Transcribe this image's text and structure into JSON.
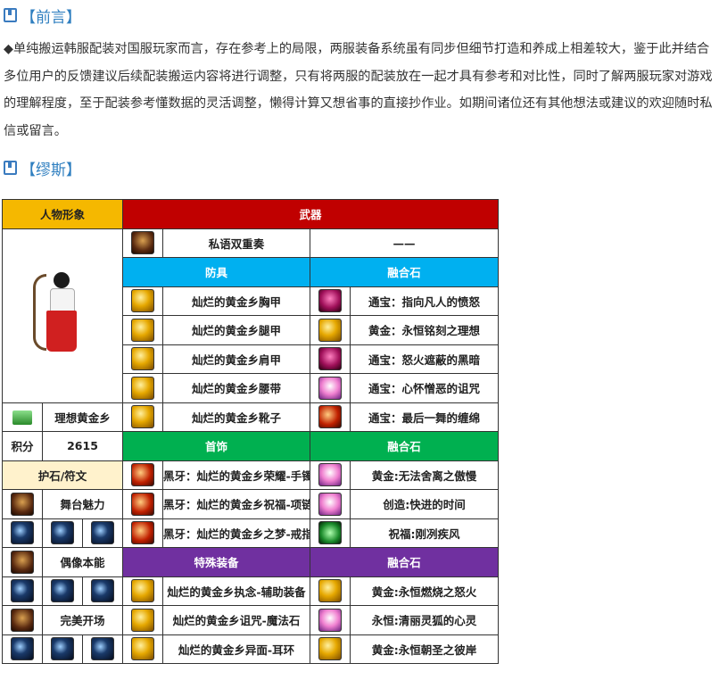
{
  "preface": {
    "title": "【前言】",
    "text": "◆单纯搬运韩服配装对国服玩家而言，存在参考上的局限，两服装备系统虽有同步但细节打造和养成上相差较大，鉴于此并结合多位用户的反馈建议后续配装搬运内容将进行调整，只有将两服的配装放在一起才具有参考和对比性，同时了解两服玩家对游戏的理解程度，至于配装参考懂数据的灵活调整，懒得计算又想省事的直接抄作业。如期间诸位还有其他想法或建议的欢迎随时私信或留言。"
  },
  "section": {
    "title": "【缪斯】"
  },
  "table": {
    "char_header": "人物形象",
    "weapon_header": "武器",
    "weapon": {
      "name": "私语双重奏",
      "fusion": "——"
    },
    "armor_header": "防具",
    "fusion_header": "融合石",
    "armor": [
      {
        "name": "灿烂的黄金乡胸甲",
        "fusion": "通宝：指向凡人的愤怒"
      },
      {
        "name": "灿烂的黄金乡腿甲",
        "fusion": "黄金：永恒铭刻之理想"
      },
      {
        "name": "灿烂的黄金乡肩甲",
        "fusion": "通宝：怒火遮蔽的黑暗"
      },
      {
        "name": "灿烂的黄金乡腰带",
        "fusion": "通宝：心怀憎恶的诅咒"
      },
      {
        "name": "灿烂的黄金乡靴子",
        "fusion": "通宝：最后一舞的缠绵"
      }
    ],
    "set_name": "理想黄金乡",
    "score_label": "积分",
    "score_value": "2615",
    "accessory_header": "首饰",
    "accessory": [
      {
        "name": "黑牙：灿烂的黄金乡荣耀-手镯",
        "fusion": "黄金:无法舍离之傲慢"
      },
      {
        "name": "黑牙：灿烂的黄金乡祝福-项链",
        "fusion": "创造:快进的时间"
      },
      {
        "name": "黑牙：灿烂的黄金乡之梦-戒指",
        "fusion": "祝福:刚冽疾风"
      }
    ],
    "talisman_header": "护石/符文",
    "talismans": [
      "舞台魅力",
      "偶像本能",
      "完美开场"
    ],
    "special_header": "特殊装备",
    "special": [
      {
        "name": "灿烂的黄金乡执念-辅助装备",
        "fusion": "黄金:永恒燃烧之怒火"
      },
      {
        "name": "灿烂的黄金乡诅咒-魔法石",
        "fusion": "永恒:清丽灵狐的心灵"
      },
      {
        "name": "灿烂的黄金乡异面-耳环",
        "fusion": "黄金:永恒朝圣之彼岸"
      }
    ]
  }
}
